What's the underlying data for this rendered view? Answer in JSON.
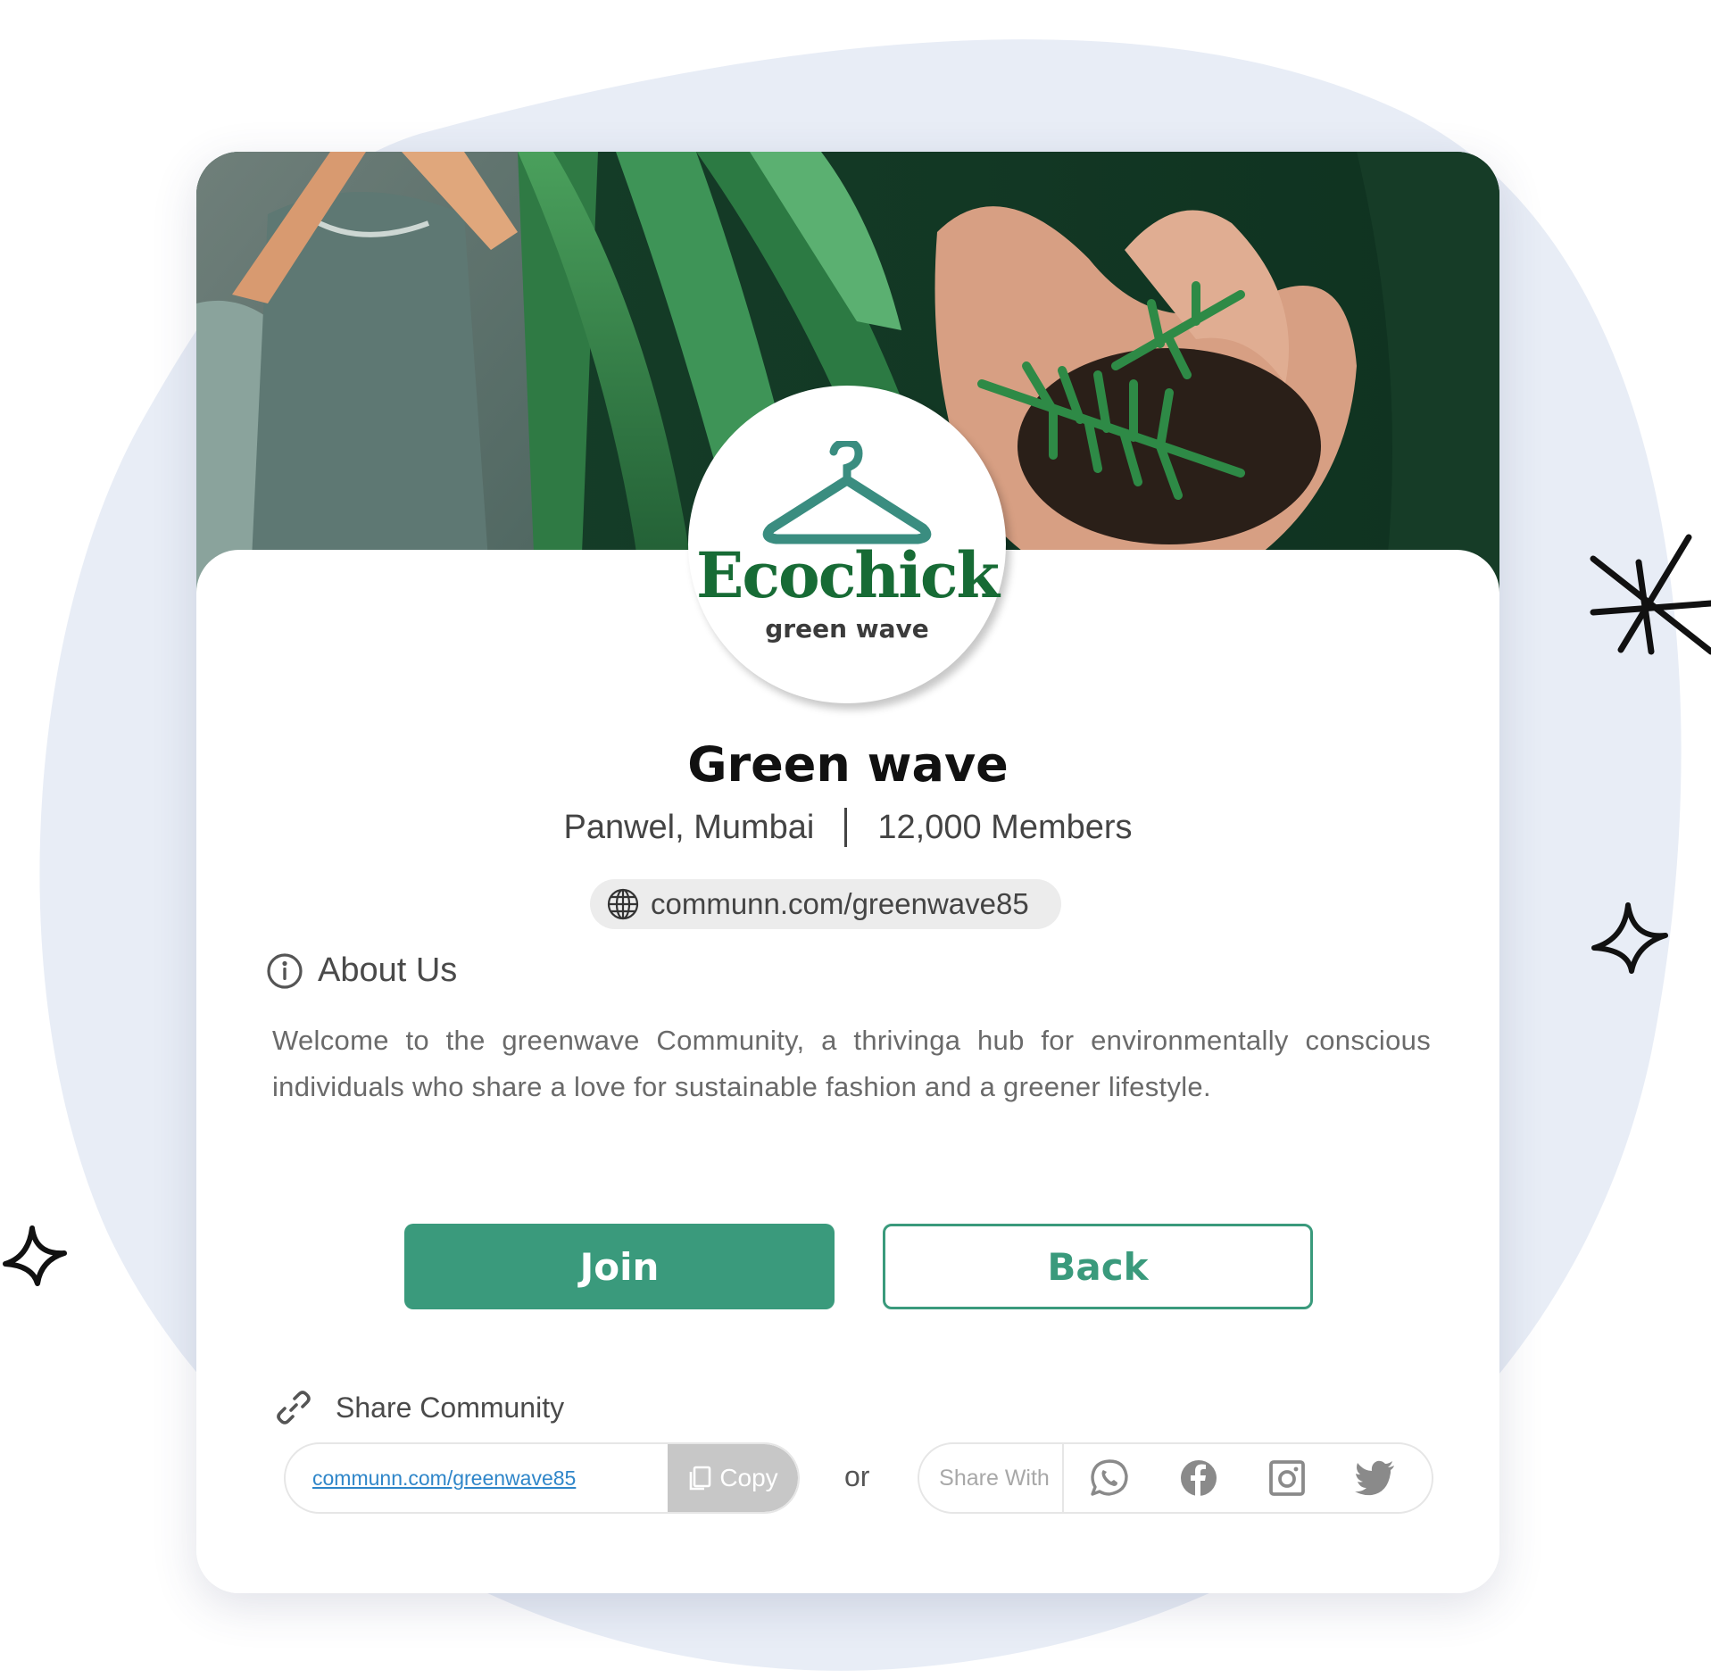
{
  "colors": {
    "accent": "#3a9a7c",
    "logo_green": "#176b35",
    "backdrop_blob": "#e8edf6",
    "link_blue": "#2f86c9"
  },
  "community": {
    "logo_name": "Ecochick",
    "logo_tagline": "green wave",
    "name": "Green wave",
    "location": "Panwel, Mumbai",
    "members": "12,000 Members",
    "url": "communn.com/greenwave85"
  },
  "about": {
    "heading": "About Us",
    "text": "Welcome to the greenwave Community, a thrivinga hub for environmentally conscious individuals who share a love for sustainable fashion and a greener lifestyle."
  },
  "actions": {
    "join_label": "Join",
    "back_label": "Back"
  },
  "share": {
    "heading": "Share Community",
    "link": "communn.com/greenwave85",
    "copy_label": "Copy",
    "or_label": "or",
    "share_with_label": "Share With",
    "platforms": [
      "whatsapp-icon",
      "facebook-icon",
      "instagram-icon",
      "twitter-icon"
    ]
  }
}
